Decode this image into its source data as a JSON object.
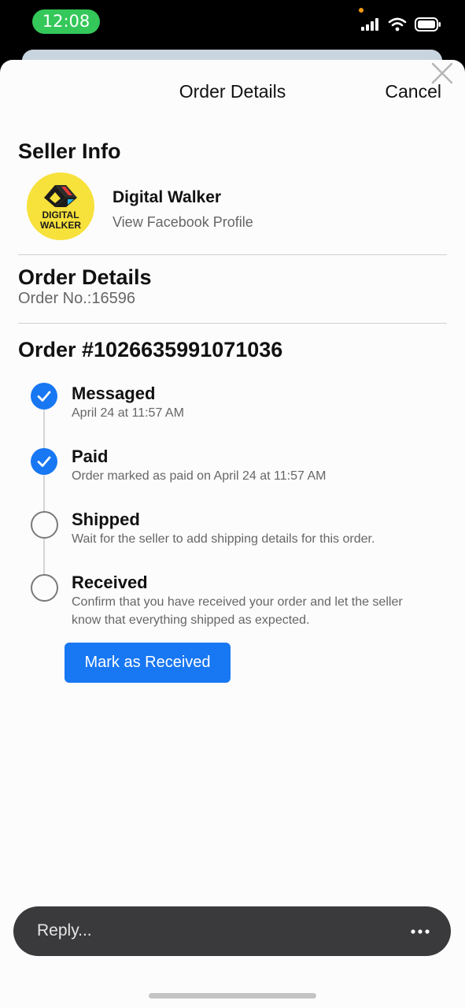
{
  "status_bar": {
    "time": "12:08"
  },
  "header": {
    "title": "Order Details",
    "cancel_label": "Cancel"
  },
  "seller_info": {
    "heading": "Seller Info",
    "logo_text_line1": "DIGITAL",
    "logo_text_line2": "WALKER",
    "name": "Digital Walker",
    "profile_link": "View Facebook Profile"
  },
  "order_details": {
    "heading": "Order Details",
    "order_number": "Order No.:16596"
  },
  "order_status": {
    "heading": "Order #1026635991071036",
    "steps": [
      {
        "title": "Messaged",
        "description": "April 24 at 11:57 AM",
        "completed": true
      },
      {
        "title": "Paid",
        "description": "Order marked as paid on April 24 at 11:57 AM",
        "completed": true
      },
      {
        "title": "Shipped",
        "description": "Wait for the seller to add shipping details for this order.",
        "completed": false
      },
      {
        "title": "Received",
        "description": "Confirm that you have received your order and let the seller know that everything shipped as expected.",
        "completed": false
      }
    ],
    "action_button": "Mark as Received"
  },
  "reply_bar": {
    "placeholder": "Reply...",
    "more_icon": "more-horizontal-icon"
  },
  "colors": {
    "accent": "#1877f2",
    "status_time_bg": "#34c759",
    "reply_bar_bg": "#3a3a3c"
  }
}
